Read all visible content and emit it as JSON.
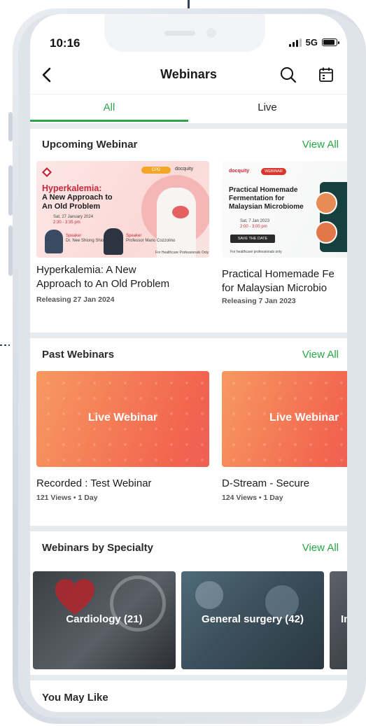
{
  "status": {
    "time": "10:16",
    "network": "5G"
  },
  "header": {
    "title": "Webinars"
  },
  "tabs": [
    {
      "label": "All"
    },
    {
      "label": "Live"
    }
  ],
  "sections": {
    "upcoming": {
      "title": "Upcoming Webinar",
      "view_all": "View All",
      "cards": [
        {
          "title_line1": "Hyperkalemia: A New",
          "title_line2": "Approach to An Old Problem",
          "meta": "Releasing 27 Jan 2024",
          "poster": {
            "headline1": "Hyperkalemia:",
            "headline2": "A New Approach to",
            "headline3": "An Old Problem",
            "date": "Sat, 27 January 2024",
            "time": "2:30 - 3:35 pm",
            "brand": "docquity",
            "badge": "CPD",
            "speaker1_role": "Speaker",
            "speaker1": "Dr. Nee Shiong Shiong",
            "speaker2_role": "Speaker",
            "speaker2": "Professor Mario Cozzolino",
            "footer": "For Healthcare Professionals Only"
          }
        },
        {
          "title_line1": "Practical Homemade Fe",
          "title_line2": "for Malaysian Microbio",
          "meta": "Releasing 7 Jan 2023",
          "poster": {
            "brand": "docquity",
            "badge": "WEBINAR",
            "headline1": "Practical Homemade",
            "headline2": "Fermentation for",
            "headline3": "Malaysian Microbiome",
            "date": "Sat, 7 Jan 2023",
            "time": "2:00 - 3:00 pm",
            "cta": "SAVE THE DATE",
            "footer": "For healthcare professionals only"
          }
        }
      ]
    },
    "past": {
      "title": "Past Webinars",
      "view_all": "View All",
      "cards": [
        {
          "banner": "Live Webinar",
          "title": "Recorded  : Test Webinar",
          "meta": "121 Views • 1 Day"
        },
        {
          "banner": "Live Webinar",
          "title": "D-Stream - Secure",
          "meta": "124 Views • 1 Day"
        }
      ]
    },
    "specialty": {
      "title": "Webinars by Specialty",
      "view_all": "View All",
      "items": [
        {
          "label": "Cardiology (21)"
        },
        {
          "label": "General surgery (42)"
        },
        {
          "label": "In"
        }
      ]
    },
    "you_may_like": {
      "title": "You May Like"
    }
  },
  "colors": {
    "accent": "#2ea44f",
    "view_all": "#27a844",
    "banner_start": "#f79961",
    "banner_end": "#ef5f53"
  },
  "icons": {
    "back": "chevron-left-icon",
    "search": "search-icon",
    "calendar": "calendar-icon"
  }
}
